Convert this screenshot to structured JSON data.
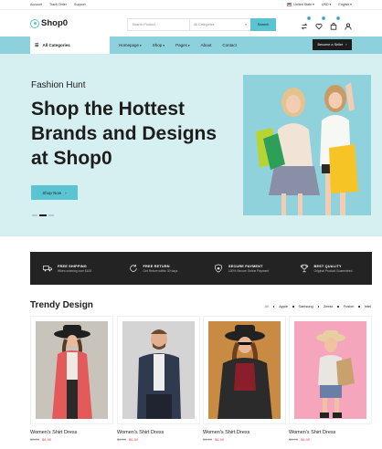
{
  "topbar": {
    "links": [
      "Account",
      "Track Order",
      "Support"
    ],
    "country": "United State",
    "currency": "USD",
    "language": "English"
  },
  "header": {
    "logo": "Shop0",
    "search_placeholder": "Search Product...",
    "category_select": "All Categories",
    "search_button": "Search",
    "compare_count": "2",
    "wishlist_count": "1",
    "cart_count": "1"
  },
  "nav": {
    "all_categories": "All Categories",
    "menu": [
      "Homepage",
      "Shop",
      "Pages",
      "About",
      "Contact"
    ],
    "seller_button": "Become a Seller"
  },
  "hero": {
    "subtitle": "Fashion Hunt",
    "title": "Shop the Hottest Brands and Designs at Shop0",
    "button": "Shop Now",
    "slide_count": 3,
    "active_slide": 2
  },
  "features": [
    {
      "title": "FREE SHIPPING",
      "desc": "When ordering over $100",
      "icon": "truck-icon"
    },
    {
      "title": "FREE RETURN",
      "desc": "Get Return within 30 days",
      "icon": "return-icon"
    },
    {
      "title": "SECURE PAYMENT",
      "desc": "100% Secure Online Payment",
      "icon": "shield-icon"
    },
    {
      "title": "BEST QUALITY",
      "desc": "Original Product Guarenteed",
      "icon": "trophy-icon"
    }
  ],
  "trendy": {
    "title": "Trendy Design",
    "tabs": [
      "All",
      "Apple",
      "Samsung",
      "Zeesx",
      "Fusion",
      "Intel"
    ],
    "active_tab": "All"
  },
  "products": [
    {
      "name": "Women's Shirt Dress",
      "old_price": "$9.99",
      "price": "$6.99"
    },
    {
      "name": "Women's Shirt Dress",
      "old_price": "$9.99",
      "price": "$6.99"
    },
    {
      "name": "Women's Shirt Dress",
      "old_price": "$9.99",
      "price": "$6.99"
    },
    {
      "name": "Women's Shirt Dress",
      "old_price": "$9.99",
      "price": "$6.99"
    }
  ],
  "colors": {
    "accent": "#5bc4d1",
    "nav_bg": "#8dd1dc",
    "hero_bg": "#d6eff1",
    "dark": "#232323",
    "sale": "#e84a4a"
  }
}
